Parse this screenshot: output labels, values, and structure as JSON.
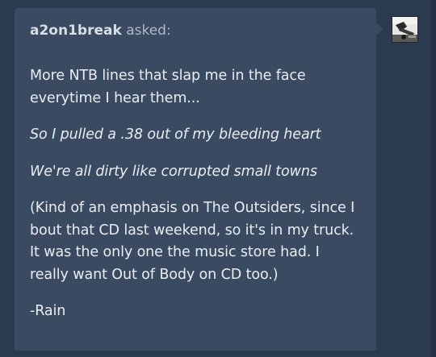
{
  "ask": {
    "asker": "a2on1break",
    "asked_label": "asked:",
    "paragraphs": [
      "More NTB lines that slap me in the face everytime I hear them...",
      "So I pulled a .38 out of my bleeding heart",
      "We're all dirty like corrupted small towns",
      "(Kind of an emphasis on The Outsiders, since I bout that CD last weekend, so it's in my truck. It was the only one the music store had. I really want Out of Body on CD too.)",
      "-Rain"
    ]
  },
  "colors": {
    "background": "#2b3a4f",
    "bubble": "#3a4a60",
    "text": "#e9edf2"
  },
  "icons": {
    "avatar": "asker-avatar-image"
  }
}
